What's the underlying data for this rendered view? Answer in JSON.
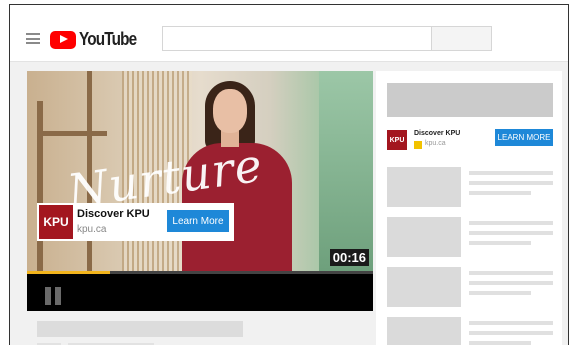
{
  "header": {
    "logo_text": "YouTube",
    "menu_icon": "hamburger-icon",
    "logo_icon": "youtube-play-icon"
  },
  "player": {
    "overlay_script": "Nurture",
    "ad": {
      "logo_text": "KPU",
      "title": "Discover KPU",
      "url": "kpu.ca",
      "cta": "Learn More"
    },
    "timestamp": "00:16",
    "progress_fraction": 0.24,
    "pause_icon": "pause-icon"
  },
  "sidebar": {
    "ad": {
      "logo_text": "KPU",
      "title": "Discover KPU",
      "url": "kpu.ca",
      "cta": "LEARN MORE"
    },
    "recommendations": 4
  },
  "colors": {
    "brand_red": "#ff0000",
    "kpu_red": "#a3161f",
    "cta_blue": "#1e88d8",
    "progress_yellow": "#f2b41c"
  }
}
